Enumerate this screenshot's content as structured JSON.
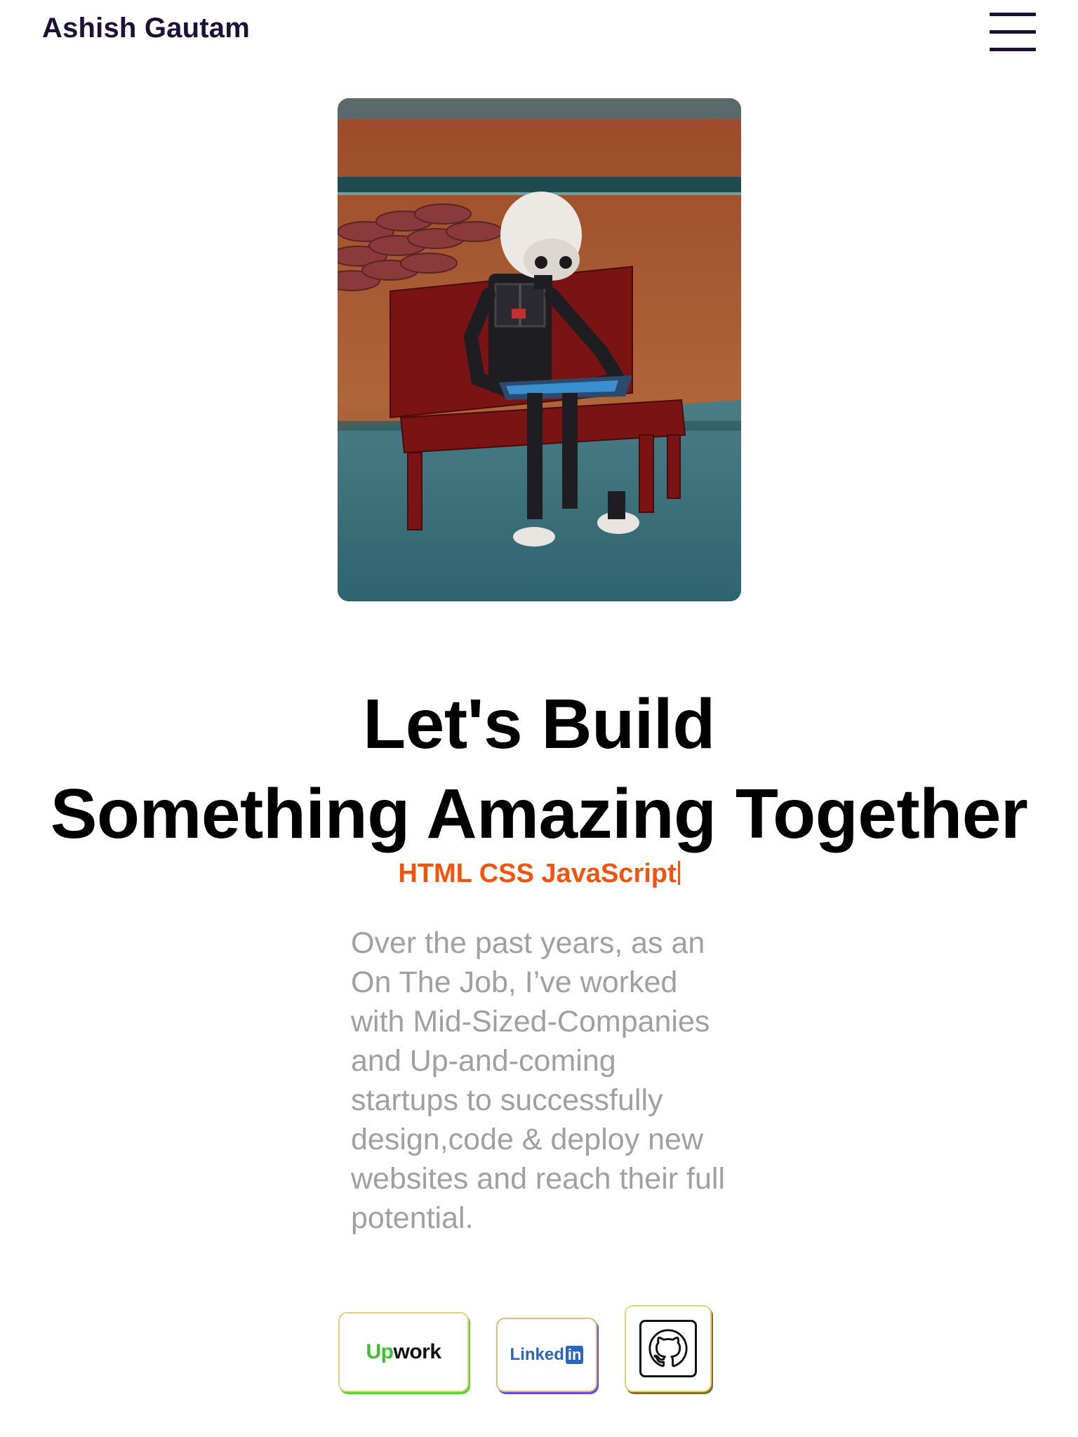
{
  "header": {
    "brand": "Ashish Gautam",
    "menu_icon": "hamburger-menu-icon"
  },
  "hero": {
    "image_subject": "robot-reading-on-bench-image",
    "headline_line1": "Let's Build",
    "headline_line2": "Something Amazing Together",
    "skills": "HTML CSS JavaScript",
    "intro": "Over the past years, as an On The Job, I’ve worked with Mid-Sized-Companies and Up-and-coming startups to successfully design,code & deploy new websites and reach their full potential."
  },
  "social": {
    "upwork": {
      "label_up": "Up",
      "label_work": "work",
      "icon": "upwork-logo-icon"
    },
    "linkedin": {
      "label": "Linked",
      "label_in": "in",
      "icon": "linkedin-logo-icon"
    },
    "github": {
      "icon": "github-logo-icon"
    }
  },
  "colors": {
    "brand_text": "#1d1036",
    "accent": "#f25410",
    "body_text": "#a0a0a0",
    "upwork_green": "#3ec12f",
    "linkedin_blue": "#2a66b8"
  }
}
